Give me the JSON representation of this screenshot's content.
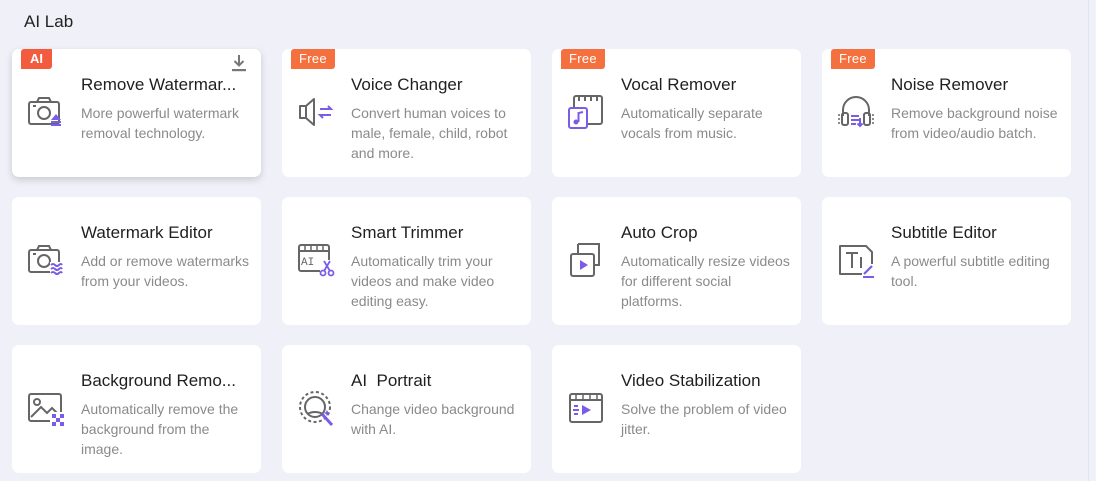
{
  "section": {
    "title": "AI Lab"
  },
  "cards": [
    {
      "title": "Remove Watermar...",
      "desc": "More powerful watermark removal technology.",
      "badge": "AI",
      "icon": "camera-remove-watermark-icon"
    },
    {
      "title": "Voice Changer",
      "desc": "Convert human voices to male, female, child, robot and more.",
      "badge": "Free",
      "icon": "speaker-voice-changer-icon"
    },
    {
      "title": "Vocal Remover",
      "desc": "Automatically separate vocals from music.",
      "badge": "Free",
      "icon": "music-vocal-remover-icon"
    },
    {
      "title": "Noise Remover",
      "desc": "Remove background noise from video/audio batch.",
      "badge": "Free",
      "icon": "headphones-noise-remover-icon"
    },
    {
      "title": "Watermark Editor",
      "desc": "Add or remove watermarks from your videos.",
      "icon": "camera-watermark-editor-icon"
    },
    {
      "title": "Smart Trimmer",
      "desc": "Automatically trim your videos and make video editing easy.",
      "icon": "ai-scissors-trimmer-icon"
    },
    {
      "title": "Auto Crop",
      "desc": "Automatically resize videos for different social platforms.",
      "icon": "crop-frame-icon"
    },
    {
      "title": "Subtitle Editor",
      "desc": "A powerful subtitle editing tool.",
      "icon": "subtitle-text-icon"
    },
    {
      "title": "Background Remo...",
      "desc": "Automatically remove the background from the image.",
      "icon": "image-background-remover-icon"
    },
    {
      "title": "AI  Portrait",
      "desc": "Change video background with AI.",
      "icon": "portrait-magic-icon"
    },
    {
      "title": "Video Stabilization",
      "desc": "Solve the problem of video jitter.",
      "icon": "video-stabilization-icon"
    }
  ],
  "colors": {
    "accent": "#7b5ce6",
    "badge": "#f35b3f",
    "icon_gray": "#6b6b6b"
  }
}
